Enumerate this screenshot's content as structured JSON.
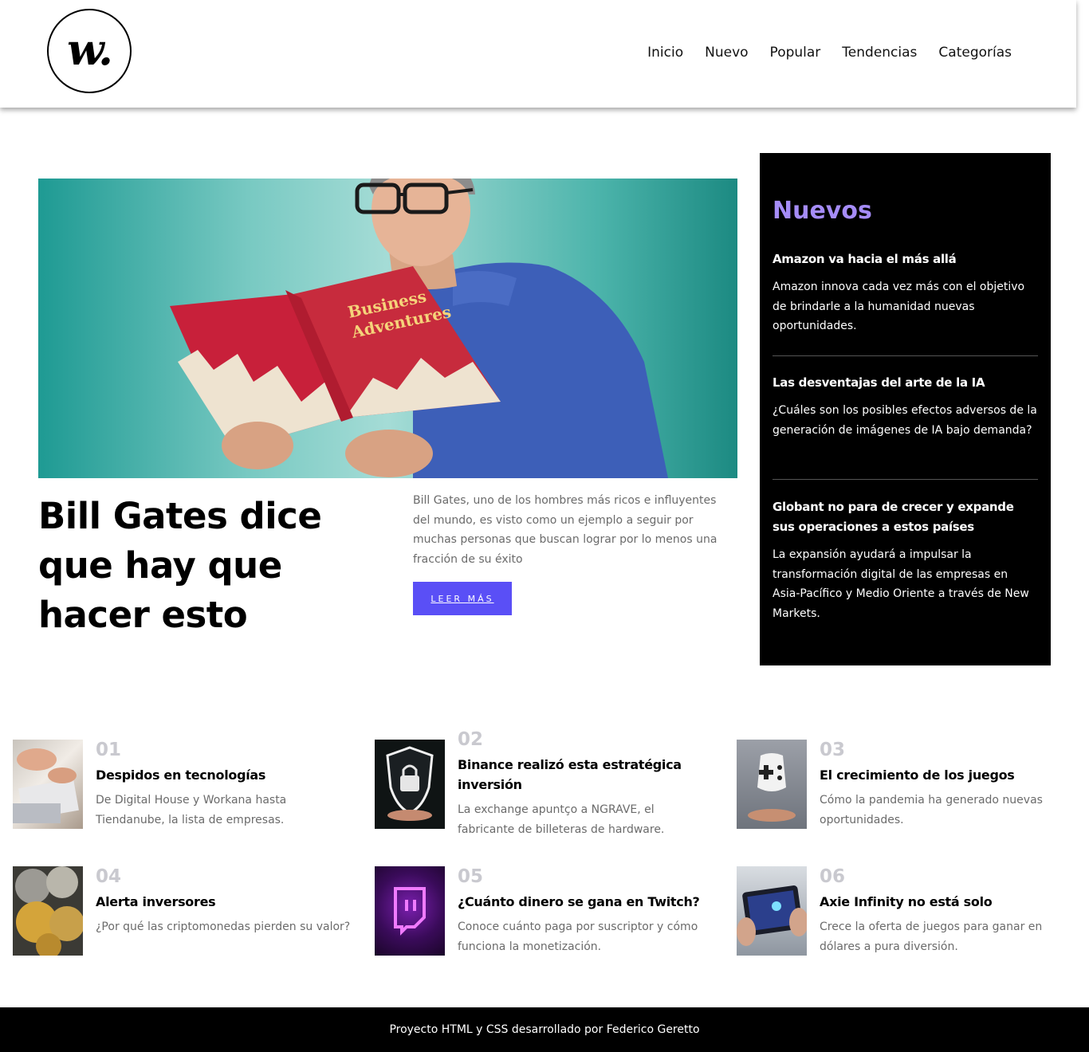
{
  "header": {
    "logo_text": "w.",
    "nav": [
      "Inicio",
      "Nuevo",
      "Popular",
      "Tendencias",
      "Categorías"
    ]
  },
  "hero": {
    "image_alt": "Bill Gates leyendo un libro",
    "book_title_1": "Business",
    "book_title_2": "Adventures",
    "title": "Bill Gates dice que hay que hacer esto",
    "description": "Bill Gates, uno de los hombres más ricos e influyentes del mundo, es visto como un ejemplo a seguir por muchas personas que buscan lograr por lo menos una fracción de su éxito",
    "button": "LEER MÁS"
  },
  "sidebar": {
    "title": "Nuevos",
    "items": [
      {
        "title": "Amazon va hacia el más allá",
        "text": "Amazon innova cada vez más con el objetivo de brindarle a la humanidad nuevas oportunidades."
      },
      {
        "title": "Las desventajas del arte de la IA",
        "text": "¿Cuáles son los posibles efectos adversos de la generación de imágenes de IA bajo demanda?"
      },
      {
        "title": "Globant no para de crecer y expande sus operaciones a estos países",
        "text": "La expansión ayudará a impulsar la transformación digital de las empresas en Asia-Pacífico y Medio Oriente a través de New Markets."
      }
    ]
  },
  "cards": [
    {
      "num": "01",
      "title": "Despidos en tecnologías",
      "text": "De Digital House y Workana hasta Tiendanube, la lista de empresas."
    },
    {
      "num": "02",
      "title": "Binance realizó esta estratégica inversión",
      "text": "La exchange apuntço a NGRAVE, el fabricante de billeteras de hardware."
    },
    {
      "num": "03",
      "title": "El crecimiento de los juegos",
      "text": "Cómo la pandemia ha generado nuevas oportunidades."
    },
    {
      "num": "04",
      "title": "Alerta inversores",
      "text": "¿Por qué las criptomonedas pierden su valor?"
    },
    {
      "num": "05",
      "title": "¿Cuánto dinero se gana en Twitch?",
      "text": "Conoce cuánto paga por suscriptor y cómo funciona la monetización."
    },
    {
      "num": "06",
      "title": "Axie Infinity no está solo",
      "text": "Crece la oferta de juegos para ganar en dólares a pura diversión."
    }
  ],
  "footer": {
    "text": "Proyecto HTML y CSS desarrollado por Federico Geretto"
  },
  "colors": {
    "accent": "#5a4ff6",
    "sidebar_title": "#a58cf7",
    "number_gray": "#c9c9cf"
  }
}
